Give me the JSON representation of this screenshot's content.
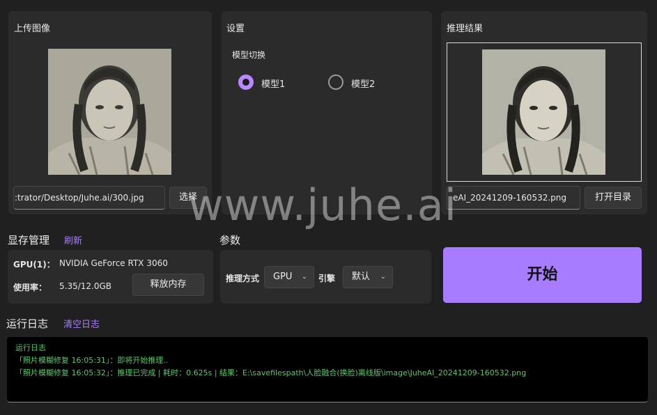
{
  "upload": {
    "title": "上传图像",
    "path_value": ":trator/Desktop/Juhe.ai/300.jpg",
    "select_label": "选择"
  },
  "settings": {
    "title": "设置",
    "model_switch_label": "模型切换",
    "models": [
      {
        "label": "模型1",
        "selected": true
      },
      {
        "label": "模型2",
        "selected": false
      }
    ]
  },
  "result": {
    "title": "推理结果",
    "path_value": "eAI_20241209-160532.png",
    "open_dir_label": "打开目录"
  },
  "memory": {
    "title": "显存管理",
    "refresh_label": "刷新",
    "gpu_key": "GPU(1)：",
    "gpu_value": "NVIDIA GeForce RTX 3060",
    "usage_key": "使用率：",
    "usage_value": "5.35/12.0GB",
    "release_label": "释放内存"
  },
  "params": {
    "title": "参数",
    "infer_mode_label": "推理方式",
    "infer_mode_value": "GPU",
    "engine_label": "引擎",
    "engine_value": "默认"
  },
  "start_label": "开始",
  "log": {
    "title": "运行日志",
    "clear_label": "清空日志",
    "lines": [
      "运行日志",
      "「照片模糊修复 16:05:31」：即将开始推理..",
      "「照片模糊修复 16:05:32」：推理已完成 | 耗时：0.625s | 结果：E:\\savefilespath\\人脸融合(换脸)离线版\\image\\JuheAI_20241209-160532.png"
    ]
  },
  "watermark": "www.juhe.ai",
  "colors": {
    "accent": "#a87cff",
    "log_text": "#57c86a",
    "background": "#202020",
    "panel": "#2b2b2b"
  }
}
